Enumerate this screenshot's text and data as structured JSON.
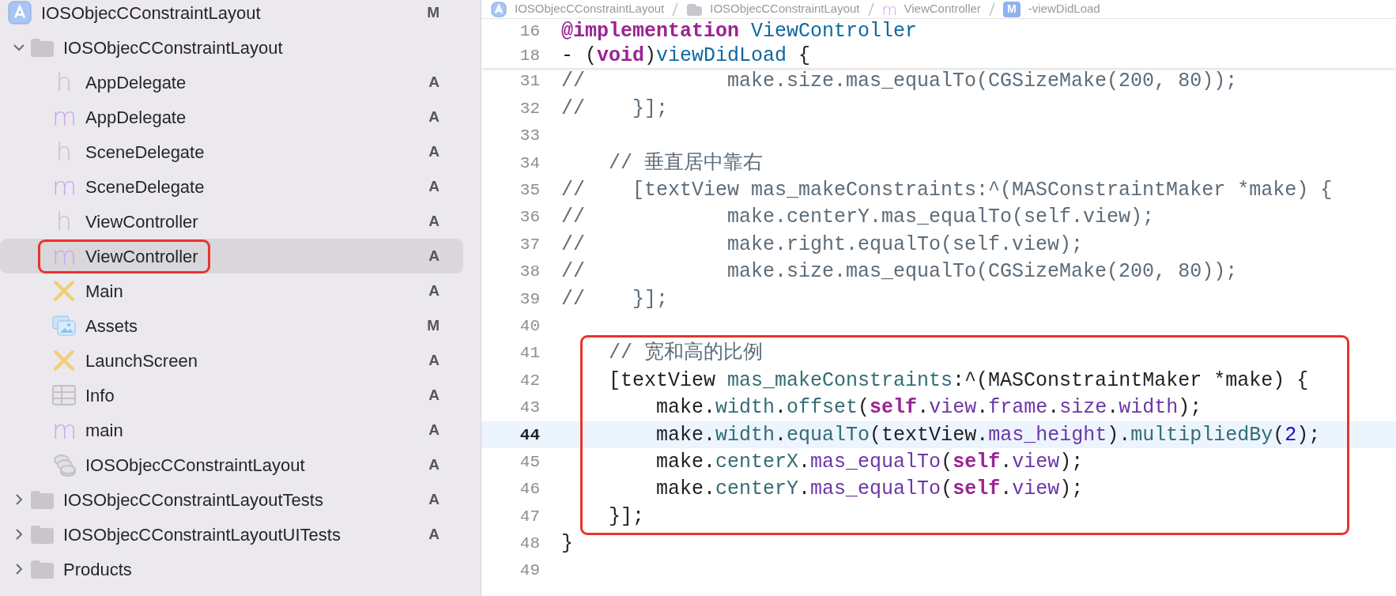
{
  "navigator": {
    "items": [
      {
        "label": "IOSObjecCConstraintLayout",
        "kind": "project",
        "status": "M",
        "selected": false,
        "boxed": false,
        "children": [
          {
            "label": "IOSObjecCConstraintLayout",
            "kind": "folder",
            "expanded": true,
            "selected": false,
            "boxed": false,
            "children": [
              {
                "label": "AppDelegate",
                "kind": "glyph",
                "glyph": "h",
                "color": "#c4c2c6",
                "status": "A",
                "selected": false,
                "boxed": false
              },
              {
                "label": "AppDelegate",
                "kind": "glyph",
                "glyph": "m",
                "color": "#c9a8ec",
                "status": "A",
                "selected": false,
                "boxed": false
              },
              {
                "label": "SceneDelegate",
                "kind": "glyph",
                "glyph": "h",
                "color": "#c4c2c6",
                "status": "A",
                "selected": false,
                "boxed": false
              },
              {
                "label": "SceneDelegate",
                "kind": "glyph",
                "glyph": "m",
                "color": "#c9a8ec",
                "status": "A",
                "selected": false,
                "boxed": false
              },
              {
                "label": "ViewController",
                "kind": "glyph",
                "glyph": "h",
                "color": "#c4c2c6",
                "status": "A",
                "selected": false,
                "boxed": false
              },
              {
                "label": "ViewController",
                "kind": "glyph",
                "glyph": "m",
                "color": "#c9a8ec",
                "status": "A",
                "selected": true,
                "boxed": true
              },
              {
                "label": "Main",
                "kind": "storyboard",
                "status": "A",
                "selected": false,
                "boxed": false
              },
              {
                "label": "Assets",
                "kind": "assets",
                "status": "M",
                "selected": false,
                "boxed": false
              },
              {
                "label": "LaunchScreen",
                "kind": "storyboard",
                "status": "A",
                "selected": false,
                "boxed": false
              },
              {
                "label": "Info",
                "kind": "plist",
                "status": "A",
                "selected": false,
                "boxed": false
              },
              {
                "label": "main",
                "kind": "glyph",
                "glyph": "m",
                "color": "#c9a8ec",
                "status": "A",
                "selected": false,
                "boxed": false
              },
              {
                "label": "IOSObjecCConstraintLayout",
                "kind": "datamodel",
                "status": "A",
                "selected": false,
                "boxed": false
              }
            ]
          },
          {
            "label": "IOSObjecCConstraintLayoutTests",
            "kind": "folder",
            "expanded": false,
            "status": "A",
            "selected": false,
            "boxed": false
          },
          {
            "label": "IOSObjecCConstraintLayoutUITests",
            "kind": "folder",
            "expanded": false,
            "status": "A",
            "selected": false,
            "boxed": false
          },
          {
            "label": "Products",
            "kind": "folder",
            "expanded": false,
            "selected": false,
            "boxed": false
          }
        ]
      }
    ]
  },
  "breadcrumb": [
    {
      "kind": "project",
      "label": "IOSObjecCConstraintLayout"
    },
    {
      "kind": "folder",
      "label": "IOSObjecCConstraintLayout"
    },
    {
      "kind": "glyph",
      "glyph": "m",
      "color": "#c9a8ec",
      "label": "ViewController"
    },
    {
      "kind": "method",
      "glyph": "M",
      "label": "-viewDidLoad"
    }
  ],
  "sticky_header": [
    {
      "number": "16",
      "tokens": [
        {
          "text": "@implementation",
          "kind": "keyword"
        },
        {
          "text": " ViewController",
          "kind": "decl"
        }
      ]
    },
    {
      "number": "18",
      "tokens": [
        {
          "text": "- (",
          "kind": "plain"
        },
        {
          "text": "void",
          "kind": "keyword"
        },
        {
          "text": ")",
          "kind": "plain"
        },
        {
          "text": "viewDidLoad",
          "kind": "decl"
        },
        {
          "text": " {",
          "kind": "plain"
        }
      ]
    }
  ],
  "code": {
    "blocks": [
      {
        "boxed": false,
        "lines": [
          {
            "number": "31",
            "current": false,
            "tokens": [
              {
                "text": "//            make.size.mas_equalTo(CGSizeMake(200, 80));",
                "kind": "comment"
              }
            ]
          },
          {
            "number": "32",
            "current": false,
            "tokens": [
              {
                "text": "//    }];",
                "kind": "comment"
              }
            ]
          },
          {
            "number": "33",
            "current": false
          },
          {
            "number": "34",
            "current": false,
            "tokens": [
              {
                "text": "    // 垂直居中靠右",
                "kind": "comment"
              }
            ]
          },
          {
            "number": "35",
            "current": false,
            "tokens": [
              {
                "text": "//    [textView mas_makeConstraints:^(MASConstraintMaker *make) {",
                "kind": "comment"
              }
            ]
          },
          {
            "number": "36",
            "current": false,
            "tokens": [
              {
                "text": "//            make.centerY.mas_equalTo(self.view);",
                "kind": "comment"
              }
            ]
          },
          {
            "number": "37",
            "current": false,
            "tokens": [
              {
                "text": "//            make.right.equalTo(self.view);",
                "kind": "comment"
              }
            ]
          },
          {
            "number": "38",
            "current": false,
            "tokens": [
              {
                "text": "//            make.size.mas_equalTo(CGSizeMake(200, 80));",
                "kind": "comment"
              }
            ]
          },
          {
            "number": "39",
            "current": false,
            "tokens": [
              {
                "text": "//    }];",
                "kind": "comment"
              }
            ]
          },
          {
            "number": "40",
            "current": false
          }
        ]
      },
      {
        "boxed": true,
        "lines": [
          {
            "number": "41",
            "current": false,
            "tokens": [
              {
                "text": "    // 宽和高的比例",
                "kind": "comment"
              }
            ]
          },
          {
            "number": "42",
            "current": false,
            "tokens": [
              {
                "text": "    [textView ",
                "kind": "plain"
              },
              {
                "text": "mas_makeConstraints",
                "kind": "method"
              },
              {
                "text": ":^(MASConstraintMaker *make) {",
                "kind": "plain"
              }
            ]
          },
          {
            "number": "43",
            "current": false,
            "tokens": [
              {
                "text": "        make.",
                "kind": "plain"
              },
              {
                "text": "width",
                "kind": "method"
              },
              {
                "text": ".",
                "kind": "plain"
              },
              {
                "text": "offset",
                "kind": "method"
              },
              {
                "text": "(",
                "kind": "plain"
              },
              {
                "text": "self",
                "kind": "keyword"
              },
              {
                "text": ".",
                "kind": "plain"
              },
              {
                "text": "view",
                "kind": "member"
              },
              {
                "text": ".",
                "kind": "plain"
              },
              {
                "text": "frame",
                "kind": "member"
              },
              {
                "text": ".",
                "kind": "plain"
              },
              {
                "text": "size",
                "kind": "member"
              },
              {
                "text": ".",
                "kind": "plain"
              },
              {
                "text": "width",
                "kind": "member"
              },
              {
                "text": ");",
                "kind": "plain"
              }
            ]
          },
          {
            "number": "44",
            "current": true,
            "tokens": [
              {
                "text": "        make.",
                "kind": "plain"
              },
              {
                "text": "width",
                "kind": "method"
              },
              {
                "text": ".",
                "kind": "plain"
              },
              {
                "text": "equalTo",
                "kind": "method"
              },
              {
                "text": "(textView.",
                "kind": "plain"
              },
              {
                "text": "mas_height",
                "kind": "member"
              },
              {
                "text": ").",
                "kind": "plain"
              },
              {
                "text": "multipliedBy",
                "kind": "method"
              },
              {
                "text": "(",
                "kind": "plain"
              },
              {
                "text": "2",
                "kind": "number"
              },
              {
                "text": ");",
                "kind": "plain"
              }
            ]
          },
          {
            "number": "45",
            "current": false,
            "tokens": [
              {
                "text": "        make.",
                "kind": "plain"
              },
              {
                "text": "centerX",
                "kind": "method"
              },
              {
                "text": ".",
                "kind": "plain"
              },
              {
                "text": "mas_equalTo",
                "kind": "member"
              },
              {
                "text": "(",
                "kind": "plain"
              },
              {
                "text": "self",
                "kind": "keyword"
              },
              {
                "text": ".",
                "kind": "plain"
              },
              {
                "text": "view",
                "kind": "member"
              },
              {
                "text": ");",
                "kind": "plain"
              }
            ]
          },
          {
            "number": "46",
            "current": false,
            "tokens": [
              {
                "text": "        make.",
                "kind": "plain"
              },
              {
                "text": "centerY",
                "kind": "method"
              },
              {
                "text": ".",
                "kind": "plain"
              },
              {
                "text": "mas_equalTo",
                "kind": "member"
              },
              {
                "text": "(",
                "kind": "plain"
              },
              {
                "text": "self",
                "kind": "keyword"
              },
              {
                "text": ".",
                "kind": "plain"
              },
              {
                "text": "view",
                "kind": "member"
              },
              {
                "text": ");",
                "kind": "plain"
              }
            ]
          },
          {
            "number": "47",
            "current": false,
            "tokens": [
              {
                "text": "    }];",
                "kind": "plain"
              }
            ]
          }
        ]
      },
      {
        "boxed": false,
        "lines": [
          {
            "number": "48",
            "current": false,
            "tokens": [
              {
                "text": "}",
                "kind": "plain"
              }
            ]
          },
          {
            "number": "49",
            "current": false
          }
        ]
      }
    ]
  }
}
